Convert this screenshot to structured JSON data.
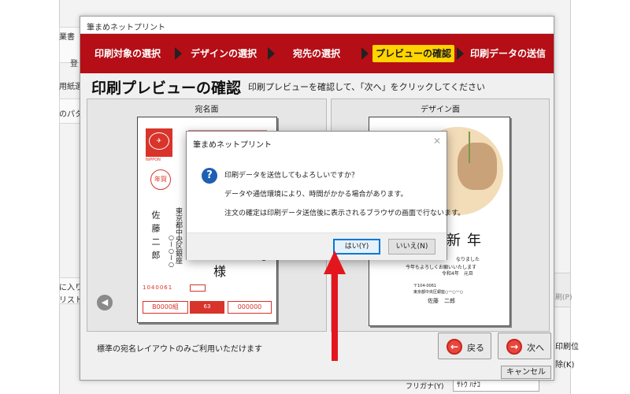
{
  "background_app": {
    "left_labels": [
      "業書",
      "登",
      "用紙選",
      "のパタ",
      "に入り",
      "リスト"
    ],
    "right_labels": [
      "印刷位",
      "除(K)",
      "刷(P)"
    ],
    "furigana_label": "フリガナ(Y)",
    "furigana_value": "ｻﾄｳ ﾊﾅｺ"
  },
  "window": {
    "title": "筆まめネットプリント"
  },
  "steps": [
    {
      "label": "印刷対象の選択",
      "active": false
    },
    {
      "label": "デザインの選択",
      "active": false
    },
    {
      "label": "宛先の選択",
      "active": false
    },
    {
      "label": "プレビューの確認",
      "active": true
    },
    {
      "label": "印刷データの送信",
      "active": false
    }
  ],
  "header": {
    "title": "印刷プレビューの確認",
    "description": "印刷プレビューを確認して、「次へ」をクリックしてください"
  },
  "preview": {
    "address_side_label": "宛名面",
    "design_side_label": "デザイン面",
    "address_card": {
      "postal_code": "1040061",
      "address_line1": "東京都中央区銀座",
      "address_line2": "○ー○ー○",
      "name_line": "佐藤二郎",
      "honorific": "様",
      "lottery_left": "B0000組",
      "lottery_right": "000000",
      "stamp_text": "年賀",
      "stamp_sub": "NIPPON",
      "stamp_price": "63"
    },
    "design_card": {
      "greeting": "新年",
      "line1": "なりました",
      "line2": "今年もよろしくお願いいたします",
      "line3": "令和4年　元旦",
      "sender_postal": "〒104-0061",
      "sender_address": "東京都中央区銀座○ー○ー○",
      "sender_name": "佐藤　二郎"
    }
  },
  "footer": {
    "note": "標準の宛名レイアウトのみご利用いただけます",
    "back_label": "戻る",
    "next_label": "次へ",
    "cancel_label": "キャンセル"
  },
  "dialog": {
    "title": "筆まめネットプリント",
    "question": "印刷データを送信してもよろしいですか？",
    "line2": "データや通信環境により、時間がかかる場合があります。",
    "line3": "注文の確定は印刷データ送信後に表示されるブラウザの画面で行ないます。",
    "yes_label": "はい(Y)",
    "no_label": "いいえ(N)"
  },
  "colors": {
    "step_bar": "#b50e16",
    "active_step": "#ffd400",
    "annotation_arrow": "#e3161e"
  }
}
